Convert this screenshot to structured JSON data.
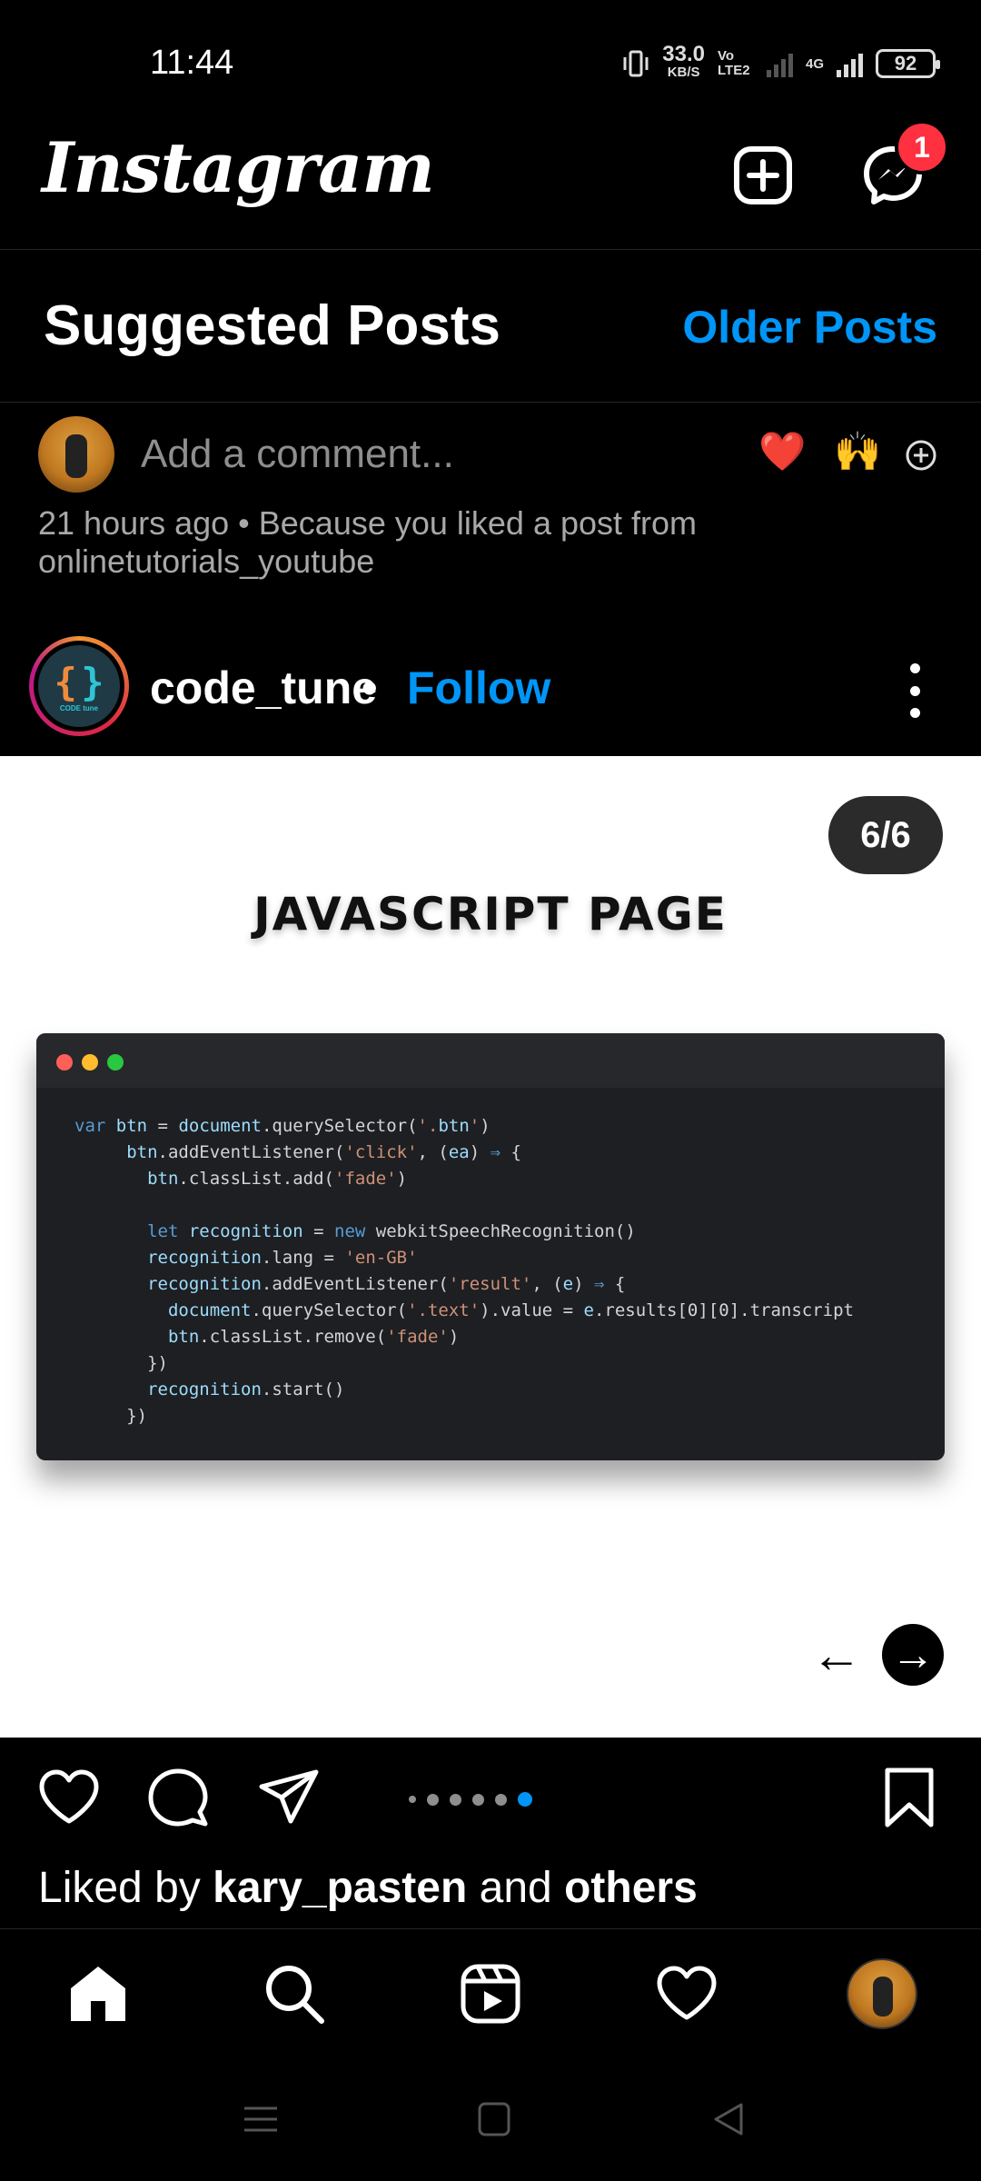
{
  "status_bar": {
    "time": "11:44",
    "speed_value": "33.0",
    "speed_unit": "KB/S",
    "volte": "Vo LTE2",
    "network": "4G",
    "battery": "92"
  },
  "header": {
    "logo": "Instagram",
    "messages_badge": "1"
  },
  "suggested": {
    "title": "Suggested Posts",
    "older_posts": "Older Posts"
  },
  "comment": {
    "placeholder": "Add a comment...",
    "emoji_1": "❤️",
    "emoji_2": "🙌"
  },
  "post_meta": "21 hours ago • Because you liked a post from onlinetutorials_youtube",
  "post": {
    "username": "code_tune",
    "separator": "•",
    "follow": "Follow",
    "brand_small": "CODE tune",
    "page_counter": "6/6",
    "slide_title": "JAVASCRIPT PAGE",
    "carousel_total": 6,
    "carousel_active": 6
  },
  "code_lines": [
    "var btn = document.querySelector('.btn')",
    "     btn.addEventListener('click', (ea) => {",
    "       btn.classList.add('fade')",
    "",
    "       let recognition = new webkitSpeechRecognition()",
    "       recognition.lang = 'en-GB'",
    "       recognition.addEventListener('result', (e) => {",
    "         document.querySelector('.text').value = e.results[0][0].transcript",
    "         btn.classList.remove('fade')",
    "       })",
    "       recognition.start()",
    "     })"
  ],
  "liked": {
    "prefix": "Liked by ",
    "user": "kary_pasten",
    "middle": " and ",
    "others": "others"
  },
  "colors": {
    "accent": "#0095f6",
    "badge": "#ff3040",
    "background": "#000000"
  }
}
